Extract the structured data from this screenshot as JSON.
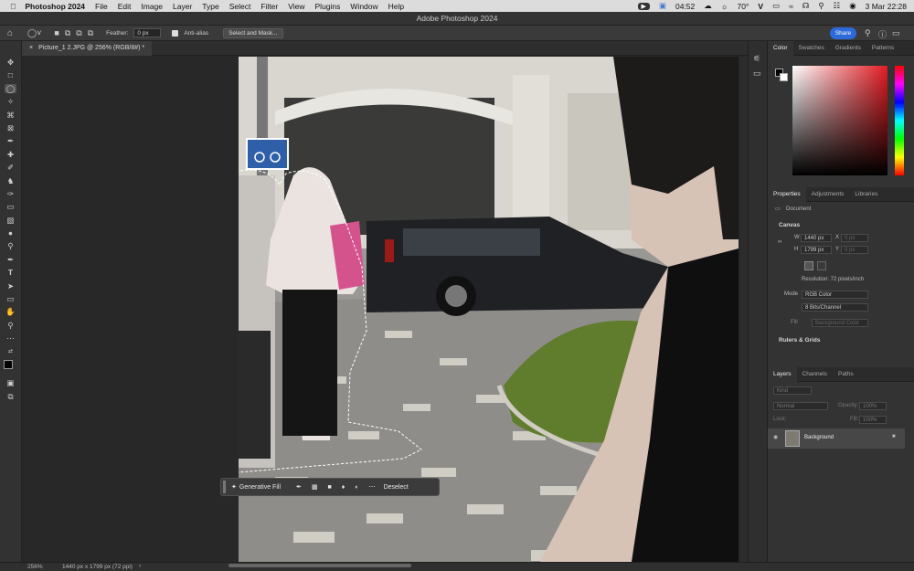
{
  "menubar": {
    "app": "Photoshop 2024",
    "items": [
      "File",
      "Edit",
      "Image",
      "Layer",
      "Type",
      "Select",
      "Filter",
      "View",
      "Plugins",
      "Window",
      "Help"
    ],
    "time": "04:52",
    "temp": "70°",
    "date": "3 Mar  22:28"
  },
  "window": {
    "title": "Adobe Photoshop 2024"
  },
  "options": {
    "feather_label": "Feather:",
    "feather_value": "0 px",
    "antialias_label": "Anti-alias",
    "select_mask": "Select and Mask...",
    "share": "Share"
  },
  "document": {
    "tab": "Picture_1 2.JPG @ 256% (RGB/8#) *"
  },
  "status": {
    "zoom": "256%",
    "info": "1440 px x 1799 px (72 ppi)"
  },
  "contextbar": {
    "generative_fill": "Generative Fill",
    "deselect": "Deselect"
  },
  "color_panel": {
    "tabs": [
      "Color",
      "Swatches",
      "Gradients",
      "Patterns"
    ]
  },
  "properties_panel": {
    "tabs": [
      "Properties",
      "Adjustments",
      "Libraries"
    ],
    "doc_label": "Document",
    "canvas_title": "Canvas",
    "w_label": "W",
    "w_value": "1440 px",
    "h_label": "H",
    "h_value": "1799 px",
    "x_label": "X",
    "x_value": "0 px",
    "y_label": "Y",
    "y_value": "0 px",
    "resolution": "Resolution: 72 pixels/inch",
    "mode_label": "Mode",
    "mode_value": "RGB Color",
    "bits_value": "8 Bits/Channel",
    "fill_label": "Fill",
    "fill_value": "Background Color",
    "rulers_title": "Rulers & Grids"
  },
  "layers_panel": {
    "tabs": [
      "Layers",
      "Channels",
      "Paths"
    ],
    "kind": "Kind",
    "blend": "Normal",
    "opacity_label": "Opacity:",
    "opacity_value": "100%",
    "lock_label": "Lock:",
    "fill_label": "Fill:",
    "fill_value": "100%",
    "layer_name": "Background"
  }
}
